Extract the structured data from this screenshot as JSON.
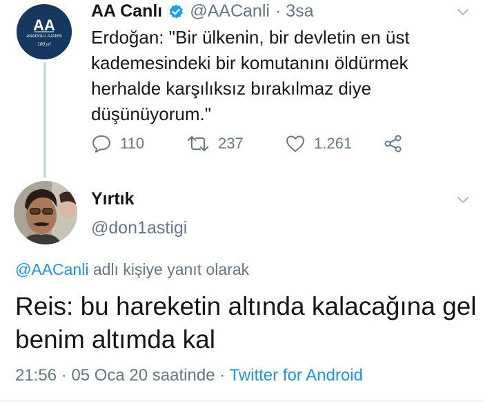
{
  "original_tweet": {
    "avatar_logo_text": "AA",
    "avatar_logo_subtext": "ANADOLU AJANSI",
    "avatar_logo_badge": "100 yıl",
    "display_name": "AA Canlı",
    "handle": "@AACanli",
    "time": "· 3sa",
    "text": "Erdoğan: \"Bir ülkenin, bir devletin en üst\nkademesindeki bir komutanını öldürmek\nherhalde karşılıksız bırakılmaz diye\ndüşünüyorum.\"",
    "replies": "110",
    "retweets": "237",
    "likes": "1.261"
  },
  "reply_tweet": {
    "display_name": "Yırtık",
    "handle": "@don1astigi",
    "reply_to_mention": "@AACanli",
    "reply_to_suffix": " adlı kişiye yanıt olarak",
    "text": "Reis: bu hareketin altında kalacağına gel benim altımda kal",
    "time": "21:56 · 05 Oca 20 saatinde · ",
    "source": "Twitter for Android"
  },
  "icons": [
    "verified-badge-icon",
    "chevron-down-icon",
    "reply-icon",
    "retweet-icon",
    "like-icon",
    "share-icon"
  ],
  "colors": {
    "accent": "#1b95e0",
    "muted": "#657786",
    "text": "#14171a",
    "aa_blue": "#16375f"
  }
}
